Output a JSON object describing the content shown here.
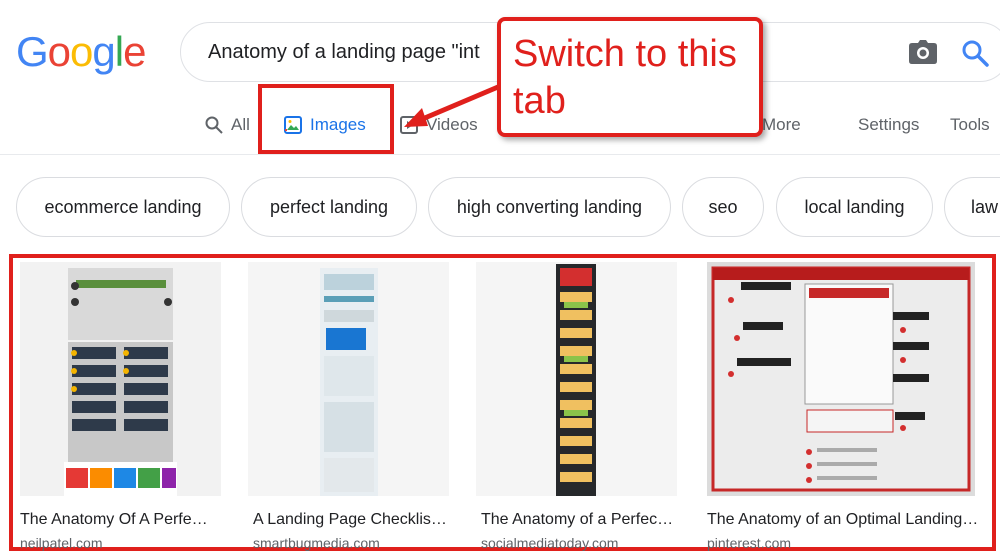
{
  "logo": {
    "letters": [
      "G",
      "o",
      "o",
      "g",
      "l",
      "e"
    ],
    "colors": [
      "#4285F4",
      "#EA4335",
      "#FBBC05",
      "#4285F4",
      "#34A853",
      "#EA4335"
    ]
  },
  "search": {
    "query": "Anatomy of a landing page \"int"
  },
  "tabs": {
    "all": "All",
    "images": "Images",
    "videos": "Videos",
    "more": "More",
    "settings": "Settings",
    "tools": "Tools"
  },
  "chips": [
    "ecommerce landing",
    "perfect landing",
    "high converting landing",
    "seo",
    "local landing",
    "law"
  ],
  "results": [
    {
      "title": "The Anatomy Of A Perfe…",
      "source": "neilpatel.com"
    },
    {
      "title": "A Landing Page Checklis…",
      "source": "smartbugmedia.com"
    },
    {
      "title": "The Anatomy of a Perfec…",
      "source": "socialmediatoday.com"
    },
    {
      "title": "The Anatomy of an Optimal Landing…",
      "source": "pinterest.com"
    }
  ],
  "callout": {
    "text": "Switch to this tab"
  },
  "colors": {
    "accent": "#1a73e8",
    "annotation": "#e0201c"
  }
}
